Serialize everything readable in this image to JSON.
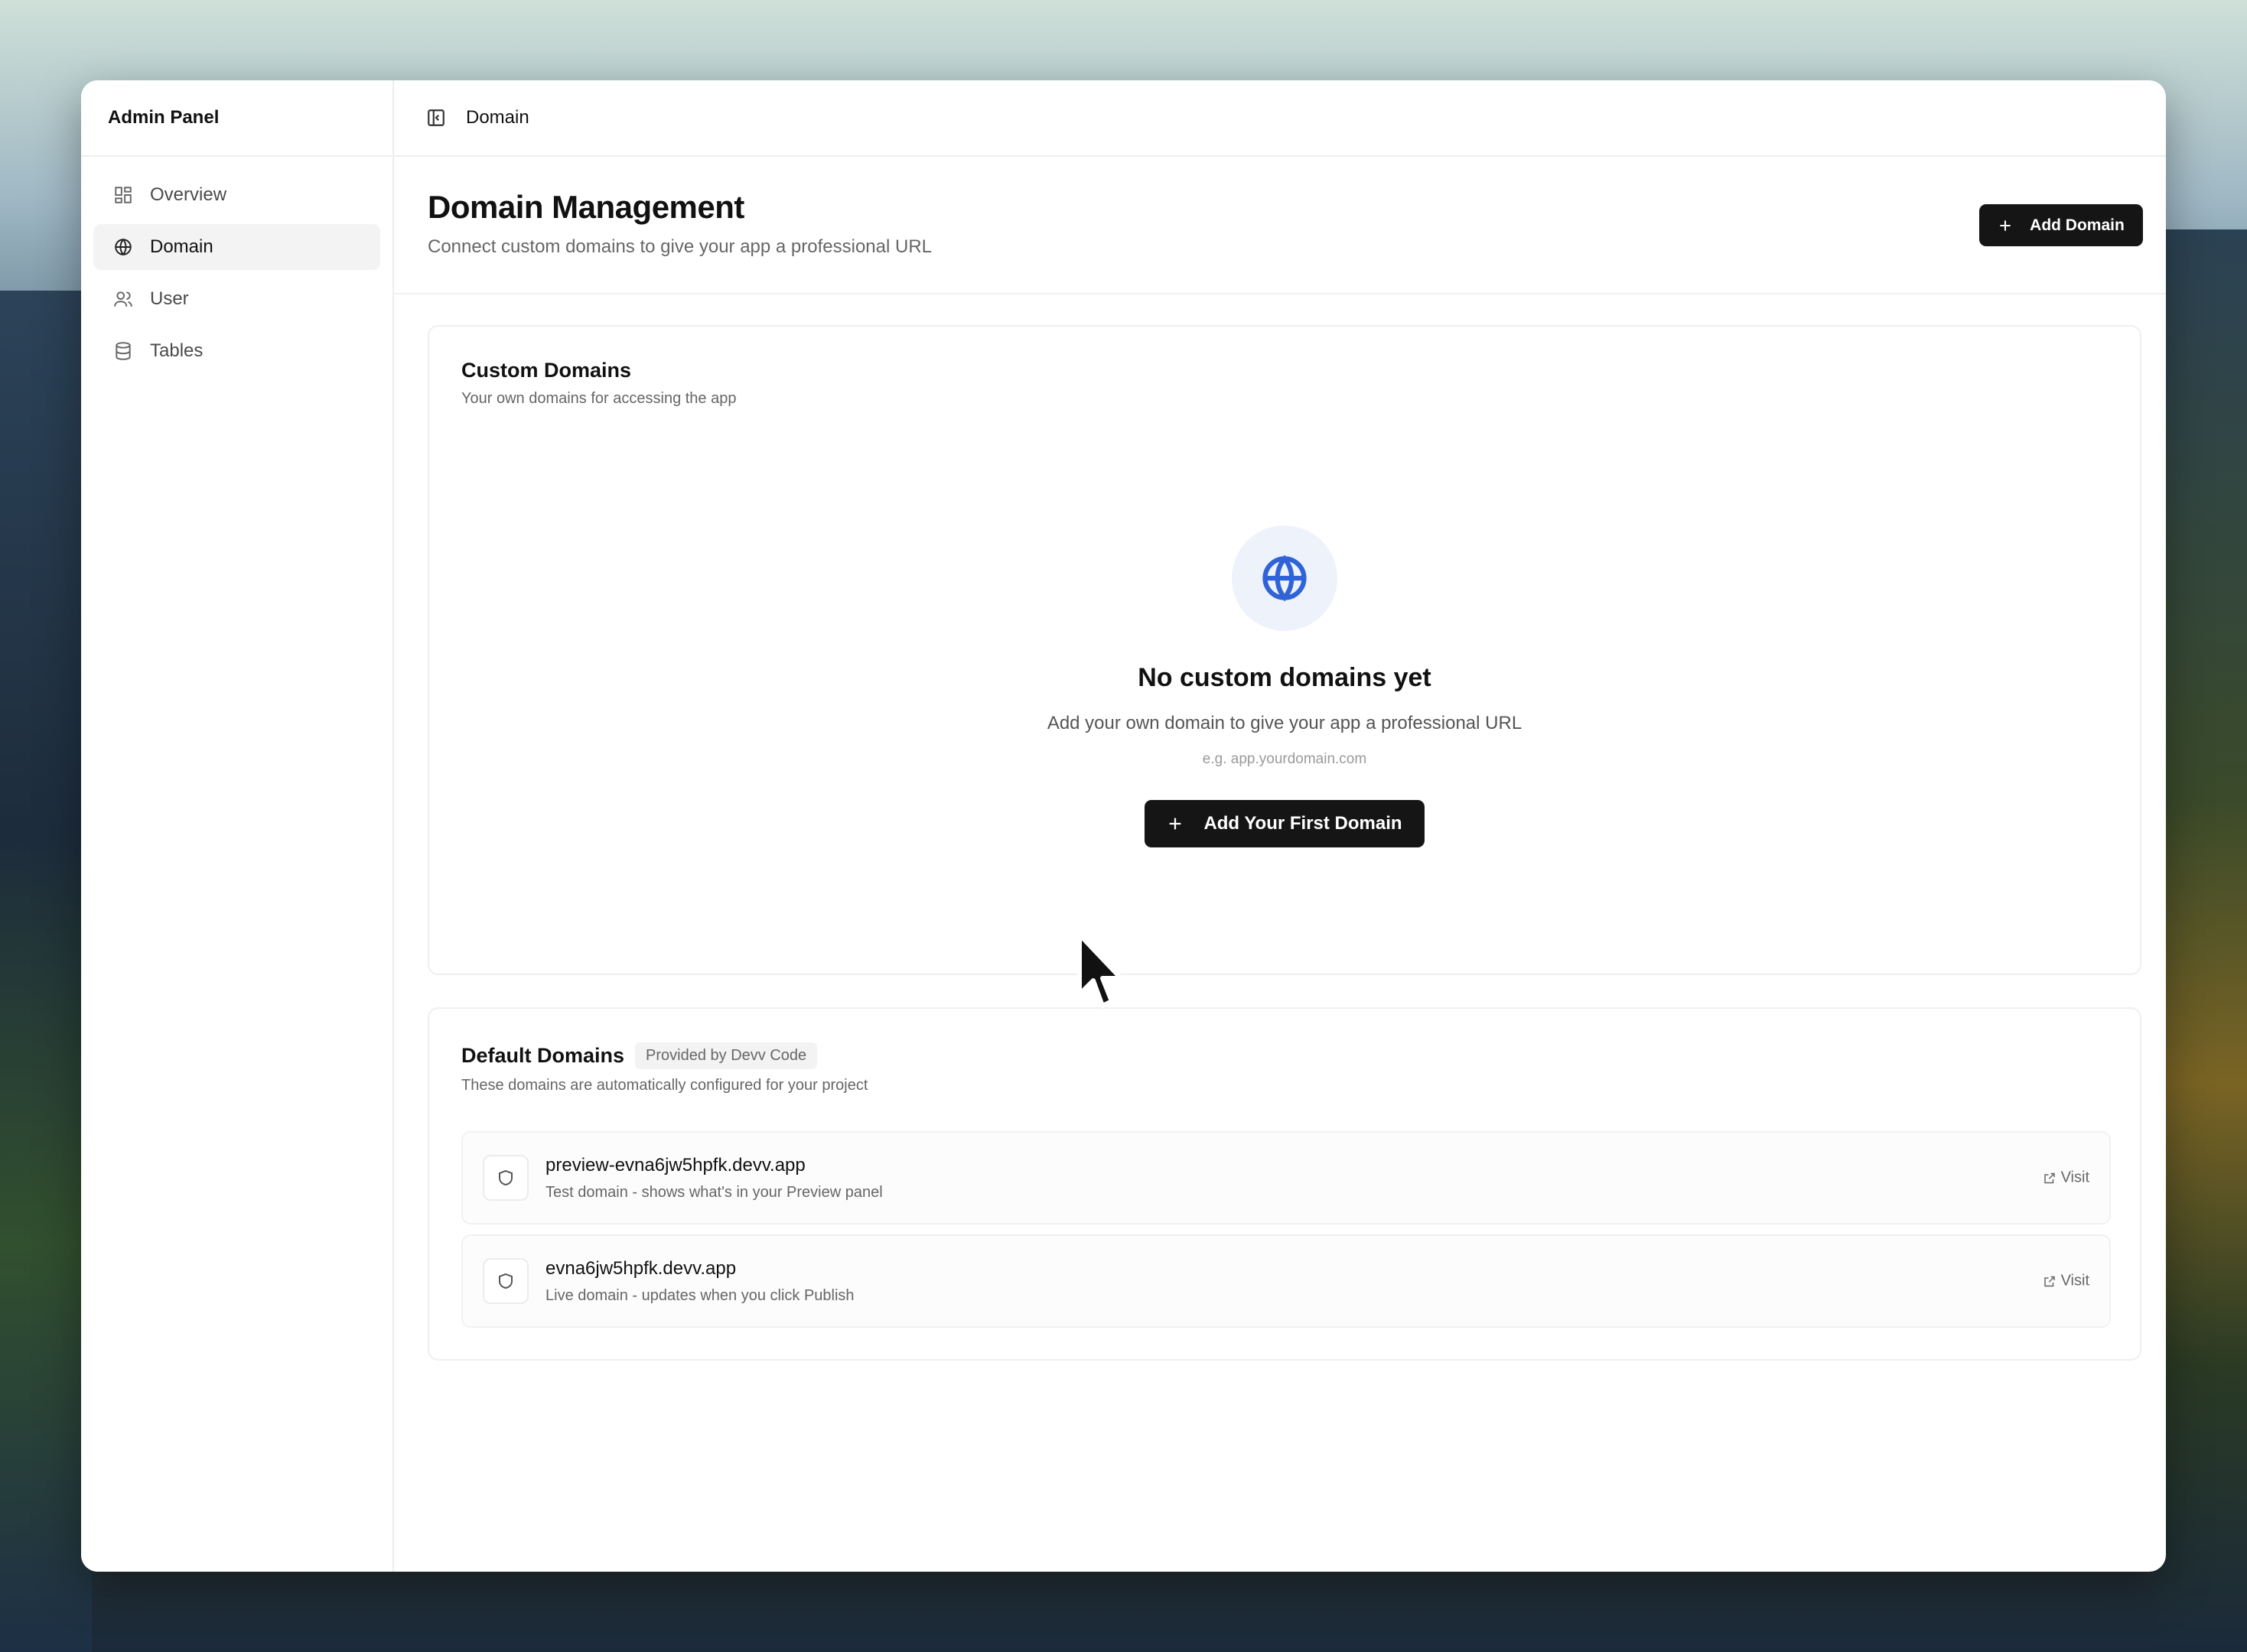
{
  "sidebar": {
    "title": "Admin Panel",
    "items": [
      {
        "label": "Overview",
        "icon": "grid-icon",
        "active": false
      },
      {
        "label": "Domain",
        "icon": "globe-icon",
        "active": true
      },
      {
        "label": "User",
        "icon": "users-icon",
        "active": false
      },
      {
        "label": "Tables",
        "icon": "database-icon",
        "active": false
      }
    ]
  },
  "topbar": {
    "toggle_icon": "sidebar-toggle-icon",
    "breadcrumb": "Domain"
  },
  "page": {
    "title": "Domain Management",
    "subtitle": "Connect custom domains to give your app a professional URL",
    "add_button": "Add Domain"
  },
  "custom_domains": {
    "title": "Custom Domains",
    "subtitle": "Your own domains for accessing the app",
    "empty_title": "No custom domains yet",
    "empty_subtitle": "Add your own domain to give your app a professional URL",
    "empty_hint": "e.g. app.yourdomain.com",
    "empty_button": "Add Your First Domain"
  },
  "default_domains": {
    "title": "Default Domains",
    "badge": "Provided by Devv Code",
    "subtitle": "These domains are automatically configured for your project",
    "rows": [
      {
        "name": "preview-evna6jw5hpfk.devv.app",
        "desc": "Test domain - shows what's in your Preview panel",
        "action": "Visit"
      },
      {
        "name": "evna6jw5hpfk.devv.app",
        "desc": "Live domain - updates when you click Publish",
        "action": "Visit"
      }
    ]
  },
  "colors": {
    "accent": "#2f63d8",
    "button": "#151515"
  }
}
